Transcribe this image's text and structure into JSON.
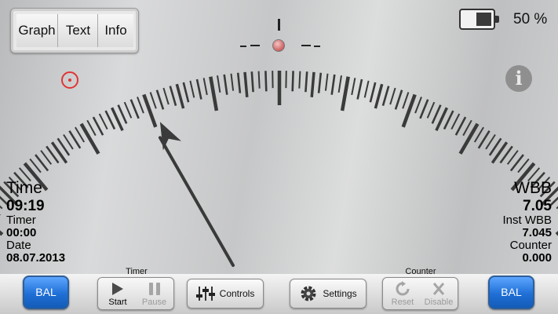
{
  "view_tabs": [
    {
      "label": "Graph"
    },
    {
      "label": "Text"
    },
    {
      "label": "Info"
    }
  ],
  "battery": {
    "percent_text": "50 %",
    "level": 0.5
  },
  "icons": {
    "target": "target-icon",
    "info": "info-icon",
    "battery": "battery-icon",
    "play": "play-icon",
    "pause": "pause-icon",
    "sliders": "sliders-icon",
    "gear": "gear-icon",
    "reset": "reset-icon",
    "disable": "disable-icon"
  },
  "gauge": {
    "needle_value": -0.45
  },
  "left_readout": {
    "time_label": "Time",
    "time_value": "09:19",
    "timer_label": "Timer",
    "timer_value": "00:00",
    "date_label": "Date",
    "date_value": "08.07.2013"
  },
  "right_readout": {
    "wbb_label": "WBB",
    "wbb_value": "7.05",
    "inst_label": "Inst WBB",
    "inst_value": "7.045",
    "counter_label": "Counter",
    "counter_value": "0.000"
  },
  "bottom": {
    "bal_left": "BAL",
    "bal_right": "BAL",
    "timer_group_label": "Timer",
    "start_label": "Start",
    "pause_label": "Pause",
    "controls_label": "Controls",
    "settings_label": "Settings",
    "counter_group_label": "Counter",
    "reset_label": "Reset",
    "disable_label": "Disable"
  },
  "colors": {
    "bal_button": "#1f6fd6",
    "target_icon": "#e03535",
    "level_dot": "#d36e6e",
    "disabled_text": "#9a9a9a"
  }
}
